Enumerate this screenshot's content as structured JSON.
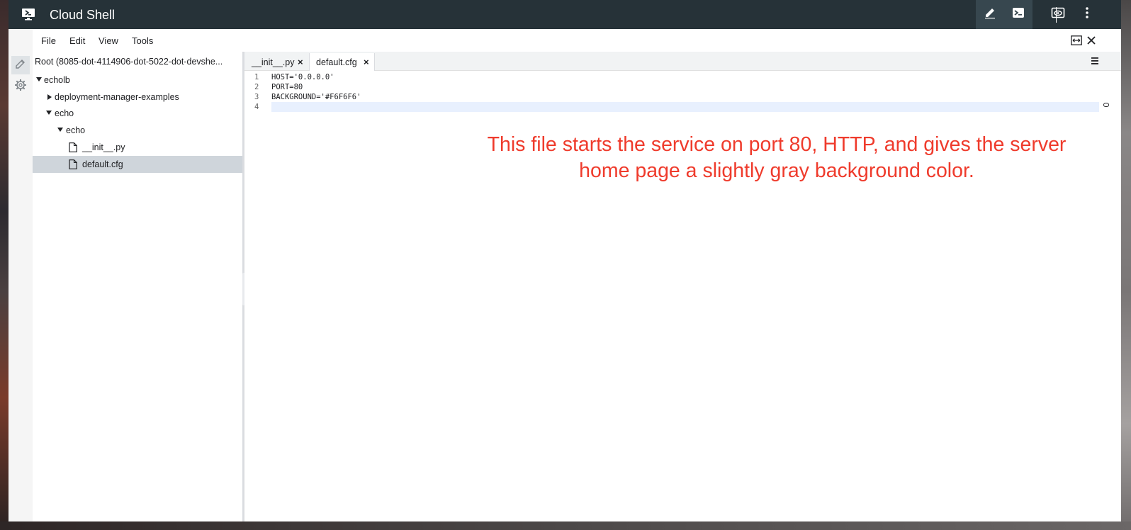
{
  "app": {
    "title": "Cloud Shell",
    "accent_dark": "#263238",
    "annotation_color": "#ef3b2c"
  },
  "titlebar": {
    "buttons": [
      {
        "name": "edit-icon",
        "active": true
      },
      {
        "name": "terminal-icon",
        "active": true
      },
      {
        "name": "preview-icon",
        "active": false
      },
      {
        "name": "more-vert-icon",
        "active": false
      }
    ]
  },
  "activity_bar": {
    "items": [
      {
        "name": "pencil-icon",
        "active": true
      },
      {
        "name": "gear-icon",
        "active": false
      }
    ]
  },
  "menubar": {
    "items": [
      "File",
      "Edit",
      "View",
      "Tools"
    ],
    "right_icons": [
      "expand-horizontal-icon",
      "close-icon"
    ]
  },
  "tree": {
    "root_label": "Root (8085-dot-4114906-dot-5022-dot-devshe...",
    "items": [
      {
        "label": "echolb",
        "type": "folder",
        "expanded": true,
        "depth": 0
      },
      {
        "label": "deployment-manager-examples",
        "type": "folder",
        "expanded": false,
        "depth": 1
      },
      {
        "label": "echo",
        "type": "folder",
        "expanded": true,
        "depth": 1
      },
      {
        "label": "echo",
        "type": "folder",
        "expanded": true,
        "depth": 2
      },
      {
        "label": "__init__.py",
        "type": "file",
        "depth": 3,
        "selected": false
      },
      {
        "label": "default.cfg",
        "type": "file",
        "depth": 3,
        "selected": true
      }
    ]
  },
  "editor": {
    "tabs": [
      {
        "label": "__init__.py",
        "active": false
      },
      {
        "label": "default.cfg",
        "active": true
      }
    ],
    "tab_close_glyph": "×",
    "lines": [
      {
        "number": "1",
        "text": "HOST='0.0.0.0'"
      },
      {
        "number": "2",
        "text": "PORT=80"
      },
      {
        "number": "3",
        "text": "BACKGROUND='#F6F6F6'"
      },
      {
        "number": "4",
        "text": ""
      }
    ],
    "current_line": 4
  },
  "annotation": {
    "line1": "This file starts the service on port 80, HTTP, and gives the server",
    "line2": "home page a slightly gray background color."
  }
}
